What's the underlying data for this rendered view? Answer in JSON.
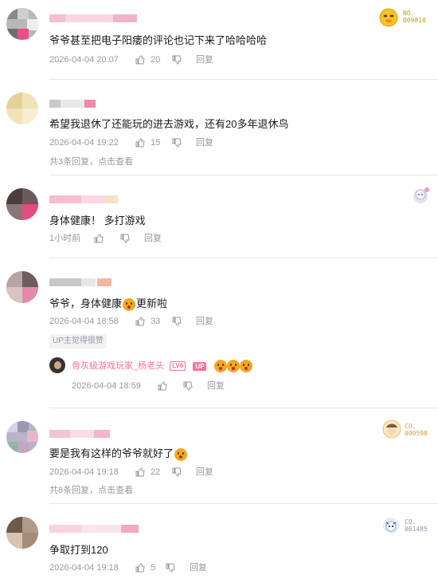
{
  "comments": [
    {
      "text": "爷爷甚至把电子阳痿的评论也记下来了哈哈哈哈",
      "time": "2026-04-04 20:07",
      "likes": "20",
      "reply_label": "回复",
      "medal": {
        "label": "NO.",
        "number": "009810"
      }
    },
    {
      "text": "希望我退休了还能玩的进去游戏，还有20多年退休鸟",
      "time": "2026-04-04 19:22",
      "likes": "15",
      "reply_label": "回复",
      "summary": "共3条回复，点击查看"
    },
    {
      "text": "身体健康！ 多打游戏",
      "time": "1小时前",
      "likes": "",
      "reply_label": "回复"
    },
    {
      "text": "爷爷，身体健康",
      "text_after": "更新啦",
      "time": "2026-04-04 18:58",
      "likes": "33",
      "reply_label": "回复",
      "up_badge": "UP主觉得很赞",
      "sub_reply": {
        "name": "骨灰级游戏玩家_杨老头",
        "lv": "LV6",
        "up": "UP",
        "time": "2026-04-04 18:59",
        "reply_label": "回复"
      }
    },
    {
      "text": "要是我有这样的爷爷就好了",
      "time": "2026-04-04 19:18",
      "likes": "22",
      "reply_label": "回复",
      "summary": "共8条回复，点击查看",
      "medal": {
        "label": "CO.",
        "number": "000598"
      }
    },
    {
      "text": "争取打到120",
      "time": "2026-04-04 19:18",
      "likes": "5",
      "reply_label": "回复",
      "medal": {
        "label": "CO.",
        "number": "001485"
      }
    }
  ],
  "icons": {
    "like": "thumbs-up-icon",
    "dislike": "thumbs-down-icon"
  },
  "colors": {
    "muted": "#9499a0",
    "text": "#18191c",
    "pink": "#fb7299",
    "divider": "#e3e5e7"
  }
}
